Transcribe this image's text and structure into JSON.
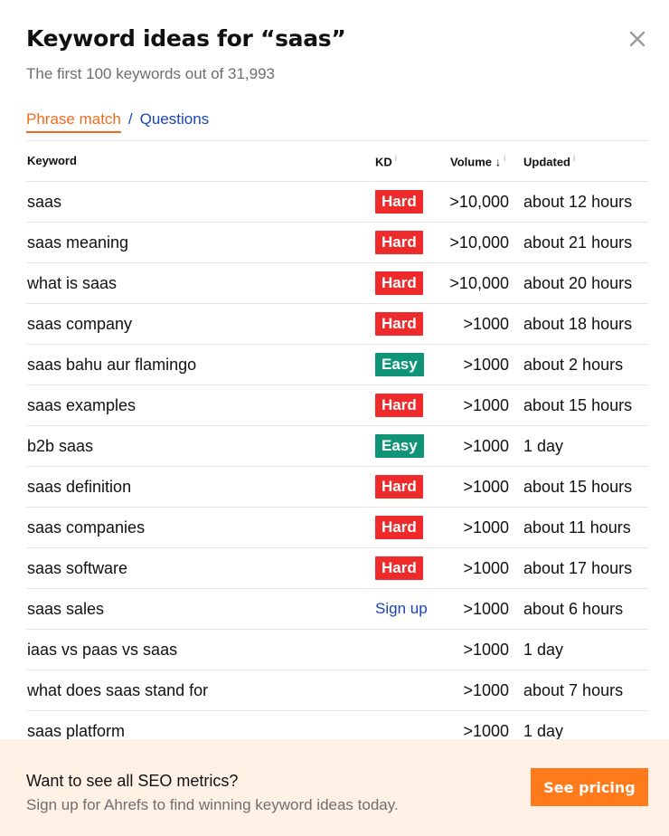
{
  "header": {
    "title": "Keyword ideas for “saas”",
    "subtitle": "The first 100 keywords out of 31,993",
    "close_icon": "close-x-icon"
  },
  "tabs": {
    "active": "Phrase match",
    "separator": "/",
    "other": "Questions"
  },
  "table": {
    "columns": {
      "keyword": "Keyword",
      "kd": "KD",
      "volume": "Volume",
      "volume_sort": "↓",
      "updated": "Updated",
      "info_glyph": "i"
    },
    "rows": [
      {
        "keyword": "saas",
        "kd": "Hard",
        "kd_type": "hard",
        "volume": ">10,000",
        "updated": "about 12 hours"
      },
      {
        "keyword": "saas meaning",
        "kd": "Hard",
        "kd_type": "hard",
        "volume": ">10,000",
        "updated": "about 21 hours"
      },
      {
        "keyword": "what is saas",
        "kd": "Hard",
        "kd_type": "hard",
        "volume": ">10,000",
        "updated": "about 20 hours"
      },
      {
        "keyword": "saas company",
        "kd": "Hard",
        "kd_type": "hard",
        "volume": ">1000",
        "updated": "about 18 hours"
      },
      {
        "keyword": "saas bahu aur flamingo",
        "kd": "Easy",
        "kd_type": "easy",
        "volume": ">1000",
        "updated": "about 2 hours"
      },
      {
        "keyword": "saas examples",
        "kd": "Hard",
        "kd_type": "hard",
        "volume": ">1000",
        "updated": "about 15 hours"
      },
      {
        "keyword": "b2b saas",
        "kd": "Easy",
        "kd_type": "easy",
        "volume": ">1000",
        "updated": "1 day"
      },
      {
        "keyword": "saas definition",
        "kd": "Hard",
        "kd_type": "hard",
        "volume": ">1000",
        "updated": "about 15 hours"
      },
      {
        "keyword": "saas companies",
        "kd": "Hard",
        "kd_type": "hard",
        "volume": ">1000",
        "updated": "about 11 hours"
      },
      {
        "keyword": "saas software",
        "kd": "Hard",
        "kd_type": "hard",
        "volume": ">1000",
        "updated": "about 17 hours"
      },
      {
        "keyword": "saas sales",
        "kd": "Sign up",
        "kd_type": "signup",
        "volume": ">1000",
        "updated": "about 6 hours"
      },
      {
        "keyword": "iaas vs paas vs saas",
        "kd": "",
        "kd_type": "none",
        "volume": ">1000",
        "updated": "1 day"
      },
      {
        "keyword": "what does saas stand for",
        "kd": "",
        "kd_type": "none",
        "volume": ">1000",
        "updated": "about 7 hours"
      },
      {
        "keyword": "saas platform",
        "kd": "",
        "kd_type": "none",
        "volume": ">1000",
        "updated": "1 day"
      }
    ]
  },
  "footer": {
    "title": "Want to see all SEO metrics?",
    "subtitle": "Sign up for Ahrefs to find winning keyword ideas today.",
    "cta": "See pricing"
  },
  "colors": {
    "hard": "#ee2a2a",
    "easy": "#0f9478",
    "link": "#1a44b8",
    "accent": "#f26b1d",
    "cta": "#ff7a1a",
    "footer_bg": "#fff1e5"
  }
}
